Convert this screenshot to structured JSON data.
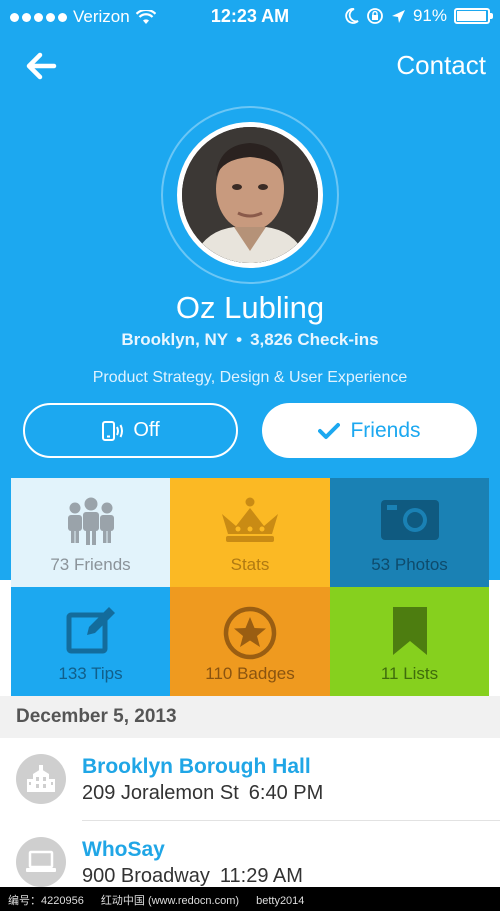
{
  "status_bar": {
    "carrier": "Verizon",
    "time": "12:23 AM",
    "battery": "91%"
  },
  "nav": {
    "contact_label": "Contact"
  },
  "profile": {
    "name": "Oz Lubling",
    "location": "Brooklyn, NY",
    "checkins": "3,826 Check-ins",
    "bio": "Product Strategy, Design & User Experience"
  },
  "actions": {
    "notifications_label": "Off",
    "friends_label": "Friends"
  },
  "tiles": [
    {
      "label": "73 Friends",
      "icon": "people-icon"
    },
    {
      "label": "Stats",
      "icon": "crown-icon"
    },
    {
      "label": "53 Photos",
      "icon": "camera-icon"
    },
    {
      "label": "133 Tips",
      "icon": "edit-icon"
    },
    {
      "label": "110 Badges",
      "icon": "badge-star-icon"
    },
    {
      "label": "11 Lists",
      "icon": "bookmark-icon"
    }
  ],
  "history": {
    "date": "December 5, 2013",
    "checkins": [
      {
        "venue": "Brooklyn Borough Hall",
        "address": "209 Joralemon St",
        "time": "6:40 PM",
        "icon": "building-icon"
      },
      {
        "venue": "WhoSay",
        "address": "900 Broadway",
        "time": "11:29 AM",
        "icon": "laptop-icon"
      }
    ]
  },
  "footer": {
    "id_text": "编号：4220956",
    "site_text": "红动中国 (www.redocn.com)",
    "author_text": "betty2014"
  },
  "colors": {
    "hero_blue": "#1ca8f0",
    "stats_yellow": "#fbb924",
    "photos_blue": "#1a81b4",
    "badges_orange": "#ef9a1f",
    "lists_green": "#86d01e"
  }
}
